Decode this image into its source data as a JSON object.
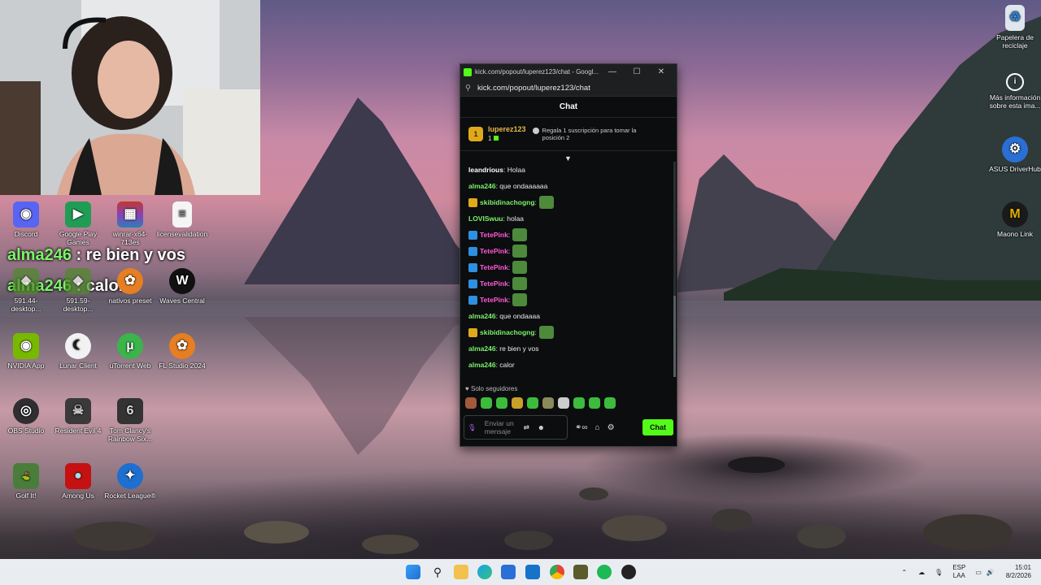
{
  "browser": {
    "tab_title": "kick.com/popout/luperez123/chat - Googl...",
    "url": "kick.com/popout/luperez123/chat"
  },
  "chat": {
    "header": "Chat",
    "pinned": {
      "rank": "1",
      "user": "luperez123",
      "count": "1",
      "gift_text": "Regala 1 suscripción para tomar la posición 2"
    },
    "messages": [
      {
        "user": "leandrious",
        "text": ": Holaa",
        "color": "#ffffff",
        "badge": ""
      },
      {
        "user": "alma246",
        "text": ": que ondaaaaaa",
        "color": "#7cf26a",
        "badge": ""
      },
      {
        "user": "skibidinachogng",
        "text": ":",
        "color": "#7cf26a",
        "badge": "#e0a81b",
        "emote": true
      },
      {
        "user": "LOVISwuu",
        "text": ": holaa",
        "color": "#7cf26a",
        "badge": ""
      },
      {
        "user": "TetePink",
        "text": ":",
        "color": "#ff5ad6",
        "badge": "#2f8fe0",
        "emote": true
      },
      {
        "user": "TetePink",
        "text": ":",
        "color": "#ff5ad6",
        "badge": "#2f8fe0",
        "emote": true
      },
      {
        "user": "TetePink",
        "text": ":",
        "color": "#ff5ad6",
        "badge": "#2f8fe0",
        "emote": true
      },
      {
        "user": "TetePink",
        "text": ":",
        "color": "#ff5ad6",
        "badge": "#2f8fe0",
        "emote": true
      },
      {
        "user": "TetePink",
        "text": ":",
        "color": "#ff5ad6",
        "badge": "#2f8fe0",
        "emote": true
      },
      {
        "user": "alma246",
        "text": ": que ondaaaa",
        "color": "#7cf26a",
        "badge": ""
      },
      {
        "user": "skibidinachogng",
        "text": ":",
        "color": "#7cf26a",
        "badge": "#e0a81b",
        "emote": true
      },
      {
        "user": "alma246",
        "text": ": re bien y vos",
        "color": "#7cf26a",
        "badge": ""
      },
      {
        "user": "alma246",
        "text": ": calor",
        "color": "#7cf26a",
        "badge": ""
      }
    ],
    "followers_only": "Solo seguidores",
    "input_placeholder": "Enviar un mensaje",
    "send_label": "Chat"
  },
  "stream_overlay": {
    "line1_user": "alma246",
    "line1_text": " : re bien y vos",
    "line2_user": "alma246",
    "line2_text": " : calor"
  },
  "desktop_icons": [
    {
      "label": "Discord",
      "icon": "discord-icon",
      "color": "#5865f2"
    },
    {
      "label": "Google Play Games",
      "icon": "google-play-games-icon",
      "color": "#1f9d55"
    },
    {
      "label": "winrar-x64-713es",
      "icon": "winrar-icon",
      "color": "#8a3fb8"
    },
    {
      "label": "licensevalidation",
      "icon": "document-icon",
      "color": "#f2f2f2"
    },
    {
      "label": "591.44-desktop...",
      "icon": "nvidia-installer-icon",
      "color": "#4f8a2a"
    },
    {
      "label": "591.59-desktop...",
      "icon": "nvidia-installer-icon",
      "color": "#4f8a2a"
    },
    {
      "label": "nativos preset",
      "icon": "fl-preset-icon",
      "color": "#e67e22"
    },
    {
      "label": "Waves Central",
      "icon": "waves-icon",
      "color": "#111111"
    },
    {
      "label": "NVIDIA App",
      "icon": "nvidia-icon",
      "color": "#76b900"
    },
    {
      "label": "Lunar Client",
      "icon": "lunar-client-icon",
      "color": "#1a1a1a"
    },
    {
      "label": "uTorrent Web",
      "icon": "utorrent-icon",
      "color": "#3bb54a"
    },
    {
      "label": "FL Studio 2024",
      "icon": "fl-studio-icon",
      "color": "#e67e22"
    },
    {
      "label": "OBS Studio",
      "icon": "obs-icon",
      "color": "#302e31"
    },
    {
      "label": "Resident Evil 4",
      "icon": "resident-evil-icon",
      "color": "#3a3a3a"
    },
    {
      "label": "Tom Clancy's Rainbow Six...",
      "icon": "rainbow-six-icon",
      "color": "#333333"
    },
    {
      "label": "Golf It!",
      "icon": "golf-it-icon",
      "color": "#4b7d3a"
    },
    {
      "label": "Among Us",
      "icon": "among-us-icon",
      "color": "#c51111"
    },
    {
      "label": "Rocket League®",
      "icon": "rocket-league-icon",
      "color": "#1d6fd1"
    }
  ],
  "right_icons": [
    {
      "label": "Papelera de reciclaje",
      "icon": "recycle-bin-icon"
    },
    {
      "label": "Más información sobre esta ima...",
      "icon": "info-icon"
    },
    {
      "label": "ASUS DriverHub",
      "icon": "asus-driverhub-icon"
    },
    {
      "label": "Maono Link",
      "icon": "maono-link-icon"
    }
  ],
  "tray": {
    "language": "ESP",
    "layout": "LAA",
    "time": "15:01",
    "date": "8/2/2026"
  }
}
